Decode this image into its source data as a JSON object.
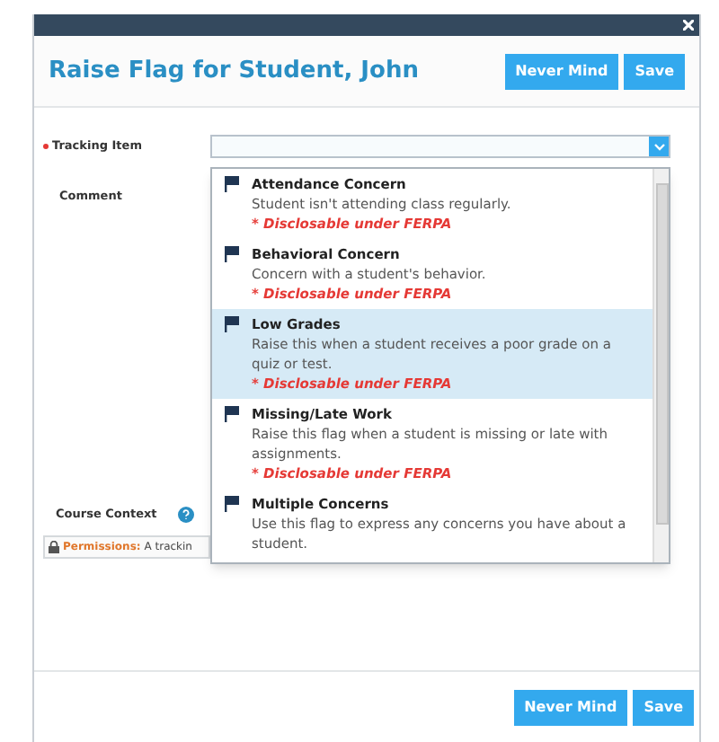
{
  "dialog": {
    "title": "Raise Flag for Student, John",
    "header_buttons": [
      "Never Mind",
      "Save"
    ],
    "footer_buttons": [
      "Never Mind",
      "Save"
    ]
  },
  "form": {
    "tracking_item": {
      "label": "Tracking Item",
      "required": true
    },
    "comment": {
      "label": "Comment"
    },
    "course_context": {
      "label": "Course Context"
    },
    "permissions": {
      "label": "Permissions:",
      "text": "A trackin"
    }
  },
  "dropdown": {
    "items": [
      {
        "title": "Attendance Concern",
        "description": "Student isn't attending class regularly.",
        "note": "* Disclosable under FERPA",
        "selected": false
      },
      {
        "title": "Behavioral Concern",
        "description": "Concern with a student's behavior.",
        "note": "* Disclosable under FERPA",
        "selected": false
      },
      {
        "title": "Low Grades",
        "description": "Raise this when a student receives a poor grade on a quiz or test.",
        "note": "* Disclosable under FERPA",
        "selected": true
      },
      {
        "title": "Missing/Late Work",
        "description": "Raise this flag when a student is missing or late with assignments.",
        "note": "* Disclosable under FERPA",
        "selected": false
      },
      {
        "title": "Multiple Concerns",
        "description": "Use this flag to express any concerns you have about a student.",
        "selected": false
      }
    ]
  }
}
